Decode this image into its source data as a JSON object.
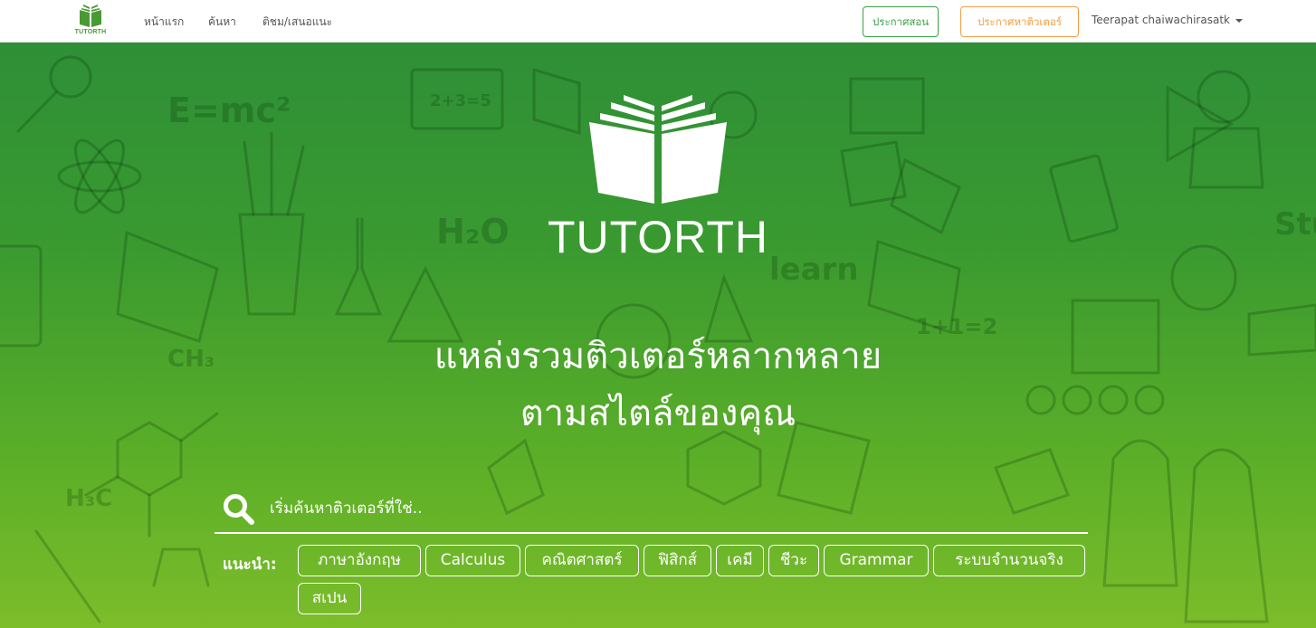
{
  "navbar": {
    "logo_text": "TUTORTH",
    "links": [
      "หน้าแรก",
      "ค้นหา",
      "ติชม/เสนอแนะ"
    ],
    "post_teach_label": "ประกาศสอน",
    "post_find_tutor_label": "ประกาศหาติวเตอร์",
    "user_name": "Teerapat chaiwachirasatk"
  },
  "hero": {
    "brand": "TUTORTH",
    "tagline_line1": "แหล่งรวมติวเตอร์หลากหลาย",
    "tagline_line2": "ตามสไตล์ของคุณ",
    "search_placeholder": "เริ่มค้นหาติวเตอร์ที่ใช่..",
    "suggest_label": "แนะนำ:",
    "suggestions": [
      "ภาษาอังกฤษ",
      "Calculus",
      "คณิตศาสตร์",
      "ฟิสิกส์",
      "เคมี",
      "ชีวะ",
      "Grammar",
      "ระบบจำนวนจริง",
      "สเปน"
    ],
    "background_doodle_text": [
      "E=mc²",
      "H₂O",
      "2+3=5",
      "CH₃",
      "H₃C",
      "1+1=2",
      "learn",
      "Stu"
    ]
  },
  "colors": {
    "brand_green": "#4a9a34",
    "teach_button": "#3ba24a",
    "find_tutor_button": "#f09d45",
    "hero_top": "#2e8f37",
    "hero_bottom": "#7cbd2a"
  }
}
